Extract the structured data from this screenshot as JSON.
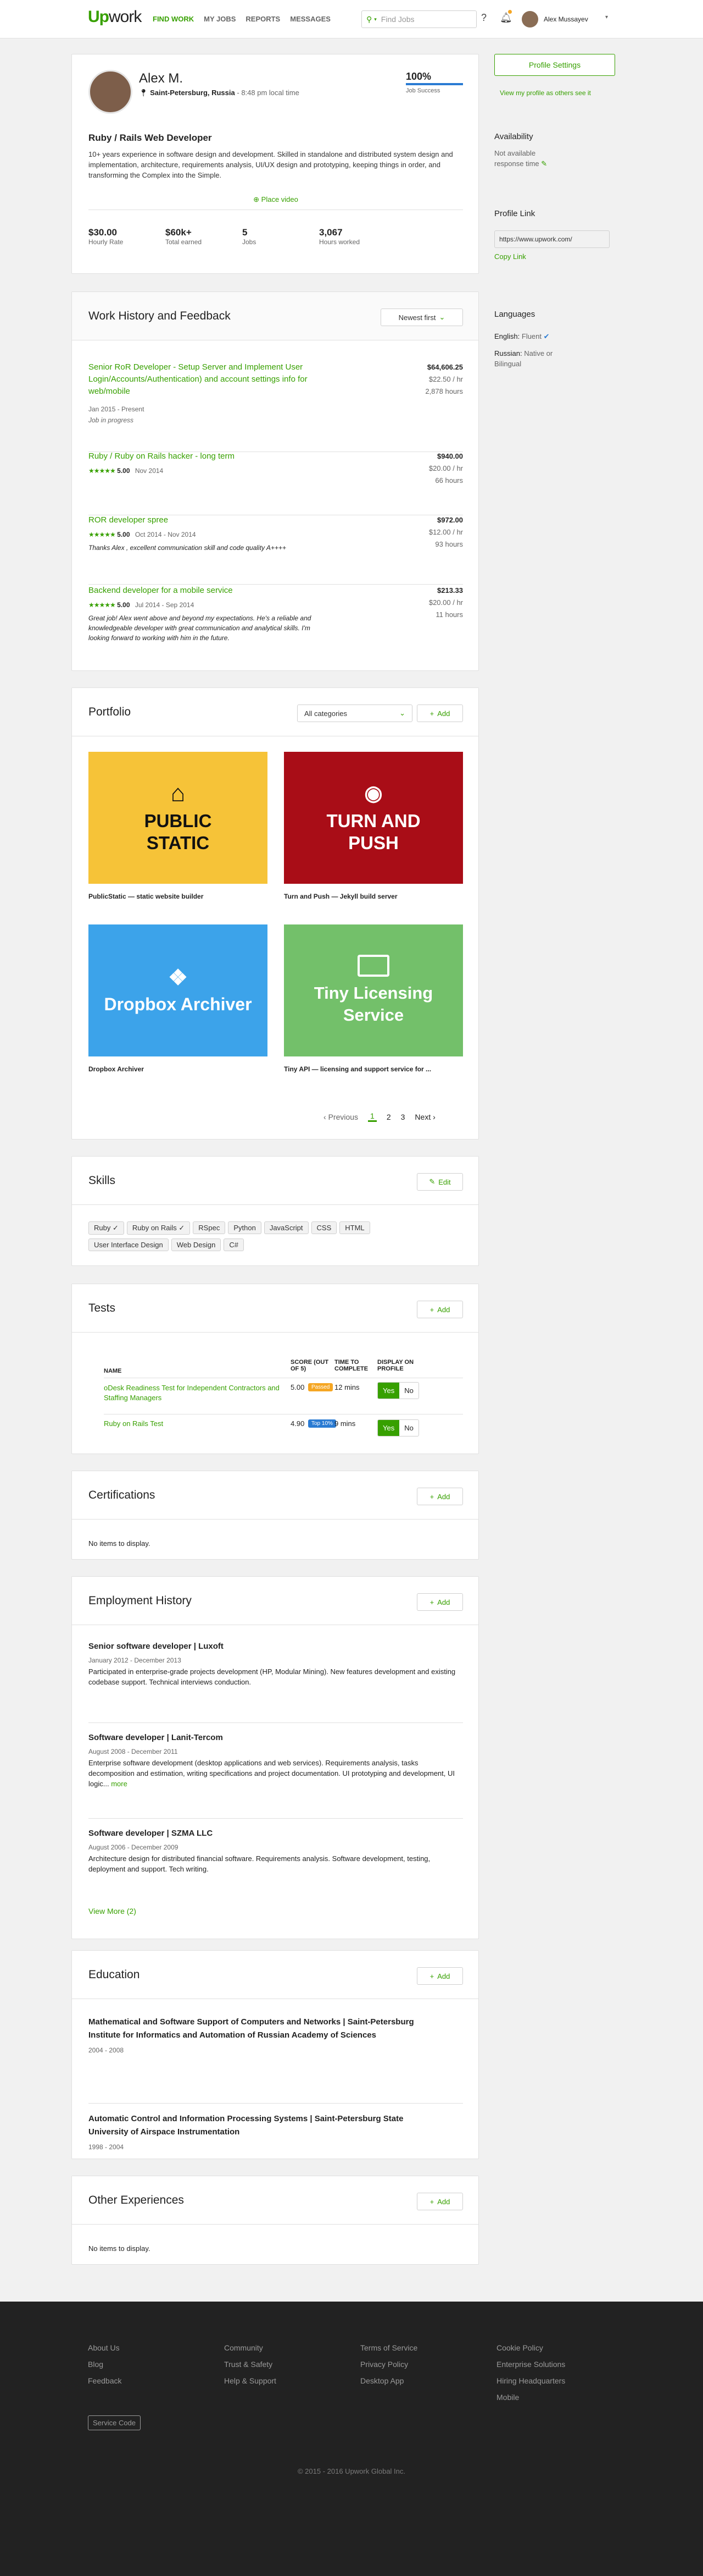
{
  "nav": {
    "logo_a": "Up",
    "logo_b": "work",
    "items": [
      "FIND WORK",
      "MY JOBS",
      "REPORTS",
      "MESSAGES"
    ],
    "search_placeholder": "Find Jobs",
    "help": "?",
    "user": "Alex Mussayev"
  },
  "profile": {
    "name": "Alex M.",
    "location": "Saint-Petersburg, Russia",
    "local_time": "- 8:48 pm local time",
    "job_success": "100%",
    "job_success_label": "Job Success",
    "title": "Ruby / Rails Web Developer",
    "overview": "10+ years experience in software design and development. Skilled in standalone and distributed system design and implementation, architecture, requirements analysis, UI/UX design and prototyping, keeping things in order, and transforming the Complex into the Simple.",
    "video": "Place video",
    "stats": [
      {
        "value": "$30.00",
        "label": "Hourly Rate"
      },
      {
        "value": "$60k+",
        "label": "Total earned"
      },
      {
        "value": "5",
        "label": "Jobs"
      },
      {
        "value": "3,067",
        "label": "Hours worked"
      }
    ]
  },
  "sidebar": {
    "settings": "Profile Settings",
    "view_link": "View my profile as others see it",
    "availability_title": "Availability",
    "availability": "Not available response time",
    "profile_link_title": "Profile Link",
    "profile_url": "https://www.upwork.com/",
    "copy": "Copy Link",
    "languages_title": "Languages",
    "lang1_name": "English:",
    "lang1_level": "Fluent",
    "lang2_name": "Russian:",
    "lang2_level": "Native or Bilingual"
  },
  "work": {
    "title": "Work History and Feedback",
    "sort": "Newest first",
    "jobs": [
      {
        "title": "Senior RoR Developer - Setup Server and Implement User Login/Accounts/Authentication) and account settings info for web/mobile",
        "dates": "Jan 2015 - Present",
        "status": "Job in progress",
        "amount": "$64,606.25",
        "rate": "$22.50 / hr",
        "hours": "2,878 hours",
        "rating": "",
        "comment": ""
      },
      {
        "title": "Ruby / Ruby on Rails hacker - long term",
        "dates": "Nov 2014",
        "status": "",
        "amount": "$940.00",
        "rate": "$20.00 / hr",
        "hours": "66 hours",
        "rating": "5.00",
        "comment": ""
      },
      {
        "title": "ROR developer spree",
        "dates": "Oct 2014 - Nov 2014",
        "status": "",
        "amount": "$972.00",
        "rate": "$12.00 / hr",
        "hours": "93 hours",
        "rating": "5.00",
        "comment": "Thanks Alex , excellent communication skill and code quality A++++"
      },
      {
        "title": "Backend developer for a mobile service",
        "dates": "Jul 2014 - Sep 2014",
        "status": "",
        "amount": "$213.33",
        "rate": "$20.00 / hr",
        "hours": "11 hours",
        "rating": "5.00",
        "comment": "Great job! Alex went above and beyond my expectations. He's a reliable and knowledgeable developer with great communication and analytical skills. I'm looking forward to working with him in the future."
      }
    ]
  },
  "portfolio": {
    "title": "Portfolio",
    "filter": "All categories",
    "add": "Add",
    "items": [
      {
        "tile": "PUBLIC STATIC",
        "caption": "PublicStatic — static website builder",
        "color": "#f6c338"
      },
      {
        "tile": "TURN AND PUSH",
        "caption": "Turn and Push — Jekyll build server",
        "color": "#a90d17"
      },
      {
        "tile": "Dropbox Archiver",
        "caption": "Dropbox Archiver",
        "color": "#3ca3ea"
      },
      {
        "tile": "Tiny Licensing Service",
        "caption": "Tiny API — licensing and support service for ...",
        "color": "#73c06a"
      }
    ],
    "pager": {
      "prev": "Previous",
      "pages": [
        "1",
        "2",
        "3"
      ],
      "next": "Next"
    }
  },
  "skills": {
    "title": "Skills",
    "edit": "Edit",
    "items": [
      "Ruby ✓",
      "Ruby on Rails ✓",
      "RSpec",
      "Python",
      "JavaScript",
      "CSS",
      "HTML",
      "User Interface Design",
      "Web Design",
      "C#"
    ]
  },
  "tests": {
    "title": "Tests",
    "add": "Add",
    "headers": [
      "NAME",
      "SCORE (OUT OF 5)",
      "TIME TO COMPLETE",
      "DISPLAY ON PROFILE"
    ],
    "rows": [
      {
        "name": "oDesk Readiness Test for Independent Contractors and Staffing Managers",
        "score": "5.00",
        "badge": "Passed",
        "badge_color": "#f5a623",
        "time": "12 mins",
        "yes": "Yes",
        "no": "No"
      },
      {
        "name": "Ruby on Rails Test",
        "score": "4.90",
        "badge": "Top 10%",
        "badge_color": "#2a7bd3",
        "time": "9 mins",
        "yes": "Yes",
        "no": "No"
      }
    ]
  },
  "certs": {
    "title": "Certifications",
    "add": "Add",
    "empty": "No items to display."
  },
  "employment": {
    "title": "Employment History",
    "add": "Add",
    "items": [
      {
        "title": "Senior software developer | Luxoft",
        "dates": "January 2012 - December 2013",
        "desc": "Participated in enterprise-grade projects development (HP, Modular Mining). New features development and existing codebase support. Technical interviews conduction."
      },
      {
        "title": "Software developer | Lanit-Tercom",
        "dates": "August 2008 - December 2011",
        "desc": "Enterprise software development (desktop applications and web services). Requirements analysis, tasks decomposition and estimation, writing specifications and project documentation. UI prototyping and development, UI logic...",
        "more": "more"
      },
      {
        "title": "Software developer | SZMA LLC",
        "dates": "August 2006 - December 2009",
        "desc": "Architecture design for distributed financial software. Requirements analysis. Software development, testing, deployment and support. Tech writing."
      }
    ],
    "view_more": "View More (2)"
  },
  "education": {
    "title": "Education",
    "add": "Add",
    "items": [
      {
        "title": "Mathematical and Software Support of Computers and Networks | Saint-Petersburg Institute for Informatics and Automation of Russian Academy of Sciences",
        "years": "2004 - 2008"
      },
      {
        "title": "Automatic Control and Information Processing Systems | Saint-Petersburg State University of Airspace Instrumentation",
        "years": "1998 - 2004"
      }
    ]
  },
  "other": {
    "title": "Other Experiences",
    "add": "Add",
    "empty": "No items to display."
  },
  "footer": {
    "col1": [
      "About Us",
      "Blog",
      "Feedback"
    ],
    "col2": [
      "Community",
      "Trust & Safety",
      "Help & Support"
    ],
    "col3": [
      "Terms of Service",
      "Privacy Policy",
      "Desktop App"
    ],
    "col4": [
      "Cookie Policy",
      "Enterprise Solutions",
      "Hiring Headquarters",
      "Mobile"
    ],
    "service_code": "Service Code",
    "copyright": "© 2015 - 2016 Upwork Global Inc."
  }
}
